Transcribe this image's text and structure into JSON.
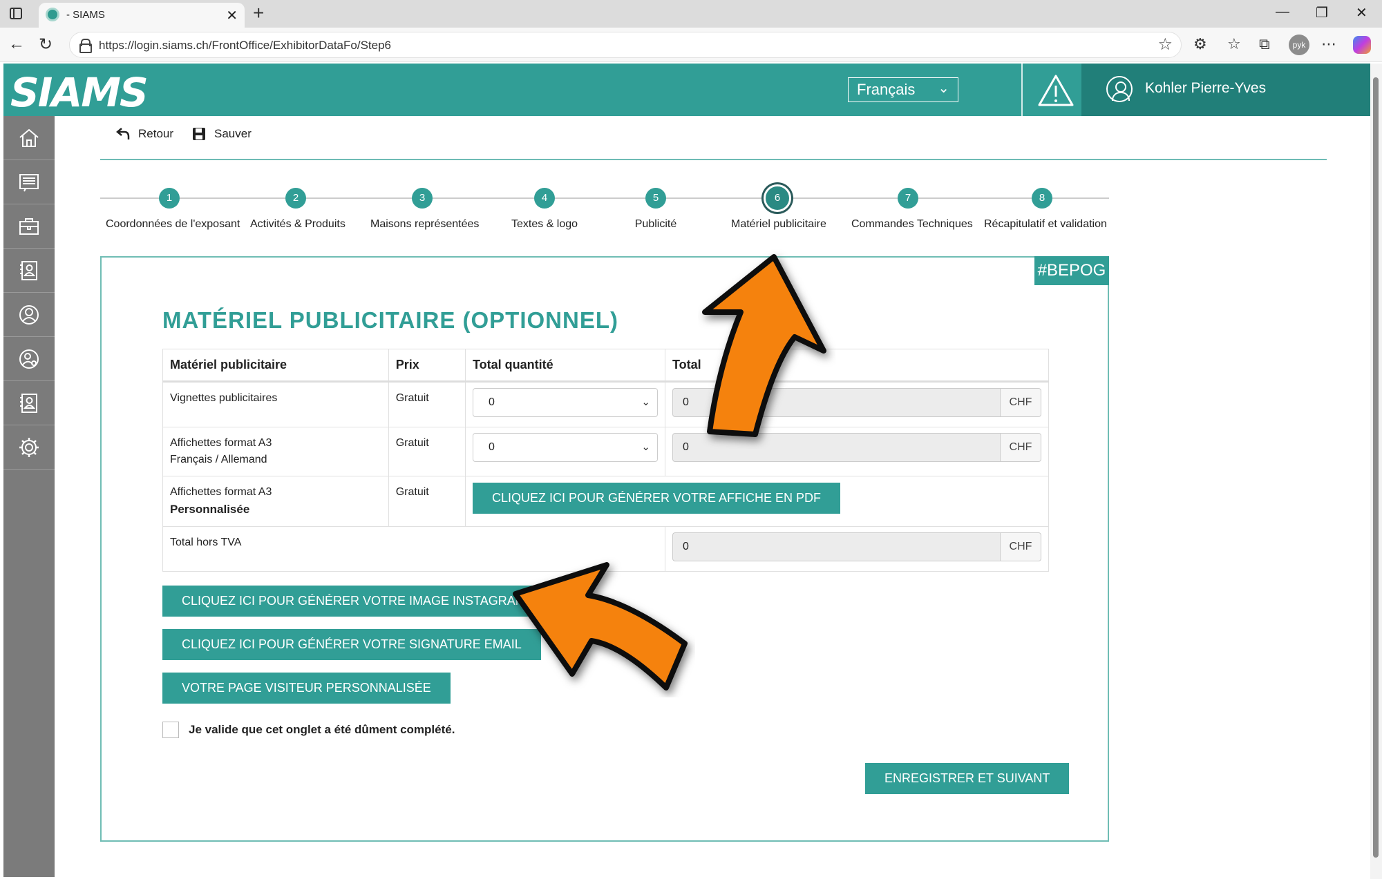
{
  "browser": {
    "tab_title": "- SIAMS",
    "tab_close": "✕",
    "new_tab": "+",
    "url": "https://login.siams.ch/FrontOffice/ExhibitorDataFo/Step6",
    "profile_initials": "pyk",
    "win_minimize": "—",
    "win_restore": "❐",
    "win_close": "✕"
  },
  "header": {
    "logo": "SIAMS",
    "language": "Français",
    "user_name": "Kohler Pierre-Yves"
  },
  "sidebar": {
    "icons": [
      "home-icon",
      "news-icon",
      "briefcase-icon",
      "contact-card-icon",
      "user-circle-icon",
      "user-settings-icon",
      "contact-card-icon",
      "gear-icon"
    ]
  },
  "toolbar": {
    "back_label": "Retour",
    "save_label": "Sauver"
  },
  "stepper": {
    "steps": [
      {
        "num": "1",
        "label": "Coordonnées de l'exposant"
      },
      {
        "num": "2",
        "label": "Activités & Produits"
      },
      {
        "num": "3",
        "label": "Maisons représentées"
      },
      {
        "num": "4",
        "label": "Textes & logo"
      },
      {
        "num": "5",
        "label": "Publicité"
      },
      {
        "num": "6",
        "label": "Matériel publicitaire"
      },
      {
        "num": "7",
        "label": "Commandes Techniques"
      },
      {
        "num": "8",
        "label": "Récapitulatif et validation"
      }
    ],
    "active": 6
  },
  "panel": {
    "tag": "#BEPOG",
    "title": "MATÉRIEL PUBLICITAIRE (OPTIONNEL)",
    "table": {
      "headers": [
        "Matériel publicitaire",
        "Prix",
        "Total quantité",
        "Total"
      ],
      "rows": [
        {
          "name": "Vignettes publicitaires",
          "price": "Gratuit",
          "quantity": "0",
          "total": "0",
          "currency": "CHF"
        },
        {
          "name": "Affichettes format A3",
          "name_sub": "Français / Allemand",
          "price": "Gratuit",
          "quantity": "0",
          "total": "0",
          "currency": "CHF"
        },
        {
          "name": "Affichettes format A3",
          "name_sub": "Personnalisée",
          "price": "Gratuit",
          "button": "CLIQUEZ ICI POUR GÉNÉRER VOTRE AFFICHE EN PDF"
        }
      ],
      "total_label": "Total hors TVA",
      "total_value": "0",
      "total_currency": "CHF"
    },
    "buttons": {
      "instagram": "CLIQUEZ ICI POUR GÉNÉRER VOTRE IMAGE INSTAGRAM",
      "signature": "CLIQUEZ ICI POUR GÉNÉRER VOTRE SIGNATURE EMAIL",
      "visitor_page": "VOTRE PAGE VISITEUR PERSONNALISÉE",
      "submit": "ENREGISTRER ET SUIVANT"
    },
    "confirm_label": "Je valide que cet onglet a été dûment complété."
  },
  "colors": {
    "brand": "#319e96",
    "brand_dark": "#217f79",
    "sidebar": "#7b7b7b",
    "arrow": "#f5820d"
  }
}
